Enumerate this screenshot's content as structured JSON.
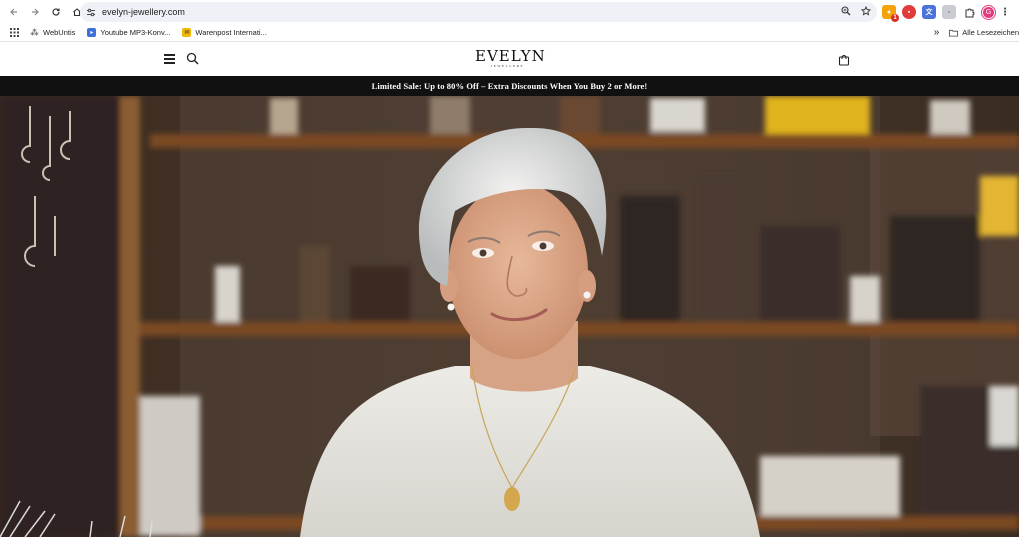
{
  "browser": {
    "url": "evelyn-jewellery.com",
    "extension_badge": "1",
    "profile_initial": "G"
  },
  "bookmarks": {
    "items": [
      {
        "label": "WebUntis",
        "color": "#5a5a5a"
      },
      {
        "label": "Youtube MP3-Konv...",
        "color": "#3f6fd8"
      },
      {
        "label": "Warenpost Internati...",
        "color": "#f2b705"
      }
    ],
    "all_bookmarks": "Alle Lesezeichen"
  },
  "site": {
    "logo": "EVELYN",
    "logo_sub": "JEWELLERY",
    "announcement": "Limited Sale: Up to 80% Off – Extra Discounts When You Buy 2 or More!"
  },
  "colors": {
    "announcement_bg": "#111111",
    "omnibox_bg": "#eef1f6",
    "shelf": "#7a4a22"
  },
  "icons": {
    "back": "back-arrow-icon",
    "forward": "forward-arrow-icon",
    "reload": "reload-icon",
    "home": "home-icon",
    "site_info": "tune-icon",
    "zoom": "zoom-icon",
    "star": "bookmark-star-icon",
    "menu": "hamburger-menu-icon",
    "search": "search-icon",
    "cart": "shopping-bag-icon"
  }
}
